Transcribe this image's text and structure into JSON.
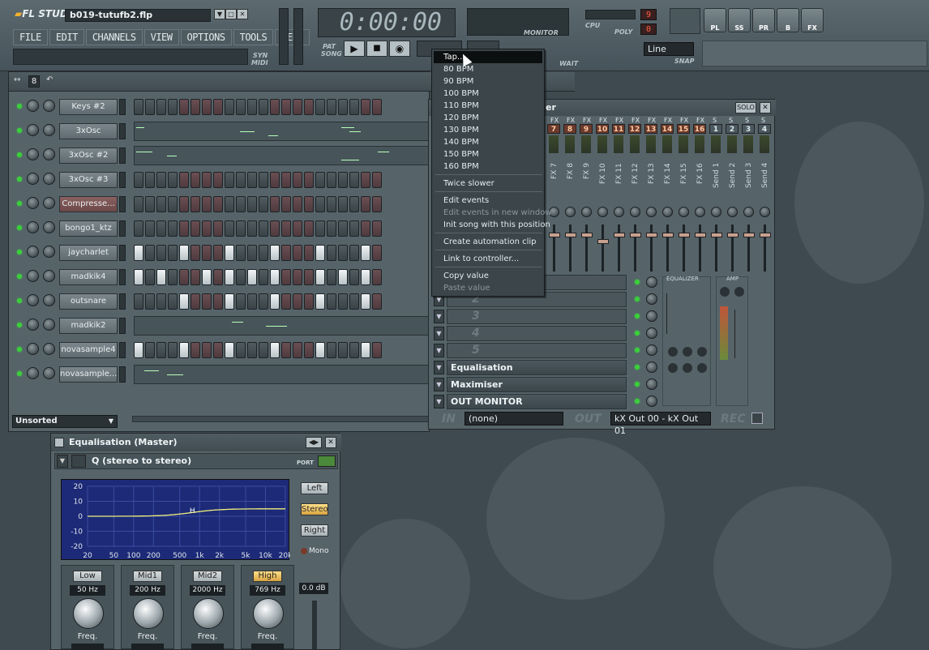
{
  "app": {
    "logo_text": "FL STUDIO",
    "project_title": "b019-tutufb2.flp"
  },
  "menu": [
    "FILE",
    "EDIT",
    "CHANNELS",
    "VIEW",
    "OPTIONS",
    "TOOLS",
    "HELP"
  ],
  "transport": {
    "time": "0:00:00",
    "pat_label": "PAT",
    "song_label": "SONG",
    "syn_label": "SYN",
    "midi_label": "MIDI",
    "monitor_label": "MONITOR",
    "cpu_label": "CPU",
    "cpu_value": "9",
    "poly_label": "POLY",
    "poly_value": "0",
    "wait_label": "WAIT",
    "snap_label": "SNAP",
    "snap_value": "Line"
  },
  "view_buttons": [
    "PL",
    "SS",
    "PR",
    "B",
    "FX"
  ],
  "channels": [
    {
      "name": "Keys #2",
      "mode": "steps",
      "pattern": "0000000000000000000000",
      "red": false
    },
    {
      "name": "3xOsc",
      "mode": "roll",
      "notes": [
        [
          2,
          10
        ],
        [
          130,
          18
        ],
        [
          165,
          12
        ],
        [
          255,
          16
        ],
        [
          265,
          14
        ]
      ],
      "red": false
    },
    {
      "name": "3xOsc #2",
      "mode": "roll",
      "notes": [
        [
          2,
          20
        ],
        [
          40,
          12
        ],
        [
          255,
          22
        ],
        [
          300,
          14
        ]
      ],
      "red": false
    },
    {
      "name": "3xOsc #3",
      "mode": "steps",
      "pattern": "0000000000000000000000",
      "red": false
    },
    {
      "name": "Compresse...",
      "mode": "steps",
      "pattern": "0000000000000000000000",
      "red": true
    },
    {
      "name": "bongo1_ktz",
      "mode": "steps",
      "pattern": "0000000000000000000000",
      "red": false
    },
    {
      "name": "jaycharlet",
      "mode": "steps",
      "pattern": "1000100010001000100010",
      "red": false
    },
    {
      "name": "madkik4",
      "mode": "steps",
      "pattern": "1010001010101000101010",
      "red": false
    },
    {
      "name": "outsnare",
      "mode": "steps",
      "pattern": "0000100010001000100010",
      "red": false
    },
    {
      "name": "madkik2",
      "mode": "roll",
      "notes": [
        [
          120,
          14
        ],
        [
          162,
          26
        ]
      ],
      "red": false
    },
    {
      "name": "novasample4",
      "mode": "steps",
      "pattern": "1000100010001000100010",
      "red": false
    },
    {
      "name": "novasample...",
      "mode": "roll",
      "notes": [
        [
          12,
          18
        ],
        [
          40,
          20
        ]
      ],
      "red": false
    }
  ],
  "channel_filter": "Unsorted",
  "context_menu": {
    "items": [
      {
        "label": "Tap...",
        "state": "selected"
      },
      {
        "label": "80 BPM",
        "state": "normal"
      },
      {
        "label": "90 BPM",
        "state": "normal"
      },
      {
        "label": "100 BPM",
        "state": "normal"
      },
      {
        "label": "110 BPM",
        "state": "normal"
      },
      {
        "label": "120 BPM",
        "state": "normal"
      },
      {
        "label": "130 BPM",
        "state": "normal"
      },
      {
        "label": "140 BPM",
        "state": "normal"
      },
      {
        "label": "150 BPM",
        "state": "normal"
      },
      {
        "label": "160 BPM",
        "state": "normal"
      },
      {
        "label": "Twice slower",
        "state": "normal"
      },
      {
        "label": "Edit events",
        "state": "normal"
      },
      {
        "label": "Edit events in new window",
        "state": "disabled"
      },
      {
        "label": "Init song with this position",
        "state": "normal"
      },
      {
        "label": "Create automation clip",
        "state": "normal"
      },
      {
        "label": "Link to controller...",
        "state": "normal"
      },
      {
        "label": "Copy value",
        "state": "normal"
      },
      {
        "label": "Paste value",
        "state": "disabled"
      }
    ]
  },
  "mixer": {
    "title_suffix": "er",
    "solo_label": "SOLO",
    "strip_header": "FX",
    "send_header": "S",
    "strips": [
      {
        "num": "7",
        "label": "FX 7"
      },
      {
        "num": "8",
        "label": "FX 8"
      },
      {
        "num": "9",
        "label": "FX 9"
      },
      {
        "num": "10",
        "label": "FX 10"
      },
      {
        "num": "11",
        "label": "FX 11"
      },
      {
        "num": "12",
        "label": "FX 12"
      },
      {
        "num": "13",
        "label": "FX 13"
      },
      {
        "num": "14",
        "label": "FX 14"
      },
      {
        "num": "15",
        "label": "FX 15"
      },
      {
        "num": "16",
        "label": "FX 16"
      },
      {
        "num": "1",
        "label": "Send 1"
      },
      {
        "num": "2",
        "label": "Send 2"
      },
      {
        "num": "3",
        "label": "Send 3"
      },
      {
        "num": "4",
        "label": "Send 4"
      }
    ],
    "slots": [
      "",
      "2",
      "3",
      "4",
      "5",
      "Equalisation",
      "Maximiser",
      "OUT MONITOR"
    ],
    "equalizer_label": "EQUALIZER",
    "amp_label": "AMP",
    "in_label": "IN",
    "in_value": "(none)",
    "out_label": "OUT",
    "out_value": "kX Out 00 - kX Out 01",
    "rec_label": "REC"
  },
  "eq": {
    "title": "Equalisation (Master)",
    "preset": "Q (stereo to stereo)",
    "port_label": "PORT",
    "y_ticks": [
      "20",
      "10",
      "0",
      "-10",
      "-20"
    ],
    "x_ticks": [
      "20",
      "50",
      "100",
      "200",
      "500",
      "1k",
      "2k",
      "5k",
      "10k",
      "20k"
    ],
    "handle_label": "H",
    "channel_buttons": [
      {
        "label": "Left",
        "active": false
      },
      {
        "label": "Stereo",
        "active": true
      },
      {
        "label": "Right",
        "active": false
      }
    ],
    "mono_label": "Mono",
    "bands": [
      {
        "name": "Low",
        "freq": "50 Hz",
        "active": false,
        "knob_label": "Freq."
      },
      {
        "name": "Mid1",
        "freq": "200 Hz",
        "active": false,
        "knob_label": "Freq."
      },
      {
        "name": "Mid2",
        "freq": "2000 Hz",
        "active": false,
        "knob_label": "Freq."
      },
      {
        "name": "High",
        "freq": "769 Hz",
        "active": true,
        "knob_label": "Freq."
      }
    ],
    "gain": "0.0 dB"
  },
  "colors": {
    "accent": "#f0b030",
    "led_green": "#3bd03b",
    "graph_bg": "#1d2a78",
    "curve": "#f0f07a"
  }
}
